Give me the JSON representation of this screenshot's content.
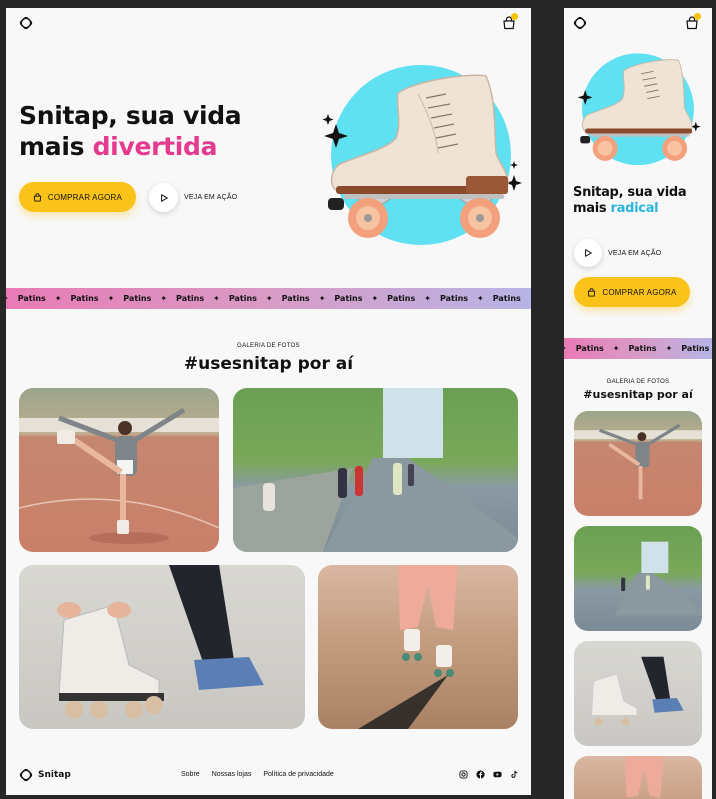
{
  "brand": {
    "name": "Snitap"
  },
  "colors": {
    "yellow": "#f9c31a",
    "pink": "#e63a8f",
    "cyan": "#2bb6dc",
    "circle": "#5fe1f2"
  },
  "desktop": {
    "hero": {
      "title_line1": "Snitap, sua vida",
      "title_line2_prefix": "mais ",
      "title_accent": "divertida"
    },
    "buy_label": "COMPRAR AGORA",
    "watch_label": "VEJA EM AÇÃO"
  },
  "mobile": {
    "hero": {
      "title_line1": "Snitap, sua vida",
      "title_line2_prefix": "mais ",
      "title_accent": "radical"
    },
    "buy_label": "COMPRAR AGORA",
    "watch_label": "VEJA EM AÇÃO"
  },
  "marquee": {
    "item": "Patins",
    "separator": "✦"
  },
  "gallery": {
    "label": "GALERIA DE FOTOS",
    "title": "#usesnitap por aí"
  },
  "footer": {
    "links": [
      "Sobre",
      "Nossas lojas",
      "Política de privacidade"
    ],
    "social": [
      "instagram-icon",
      "facebook-icon",
      "youtube-icon",
      "tiktok-icon"
    ]
  }
}
